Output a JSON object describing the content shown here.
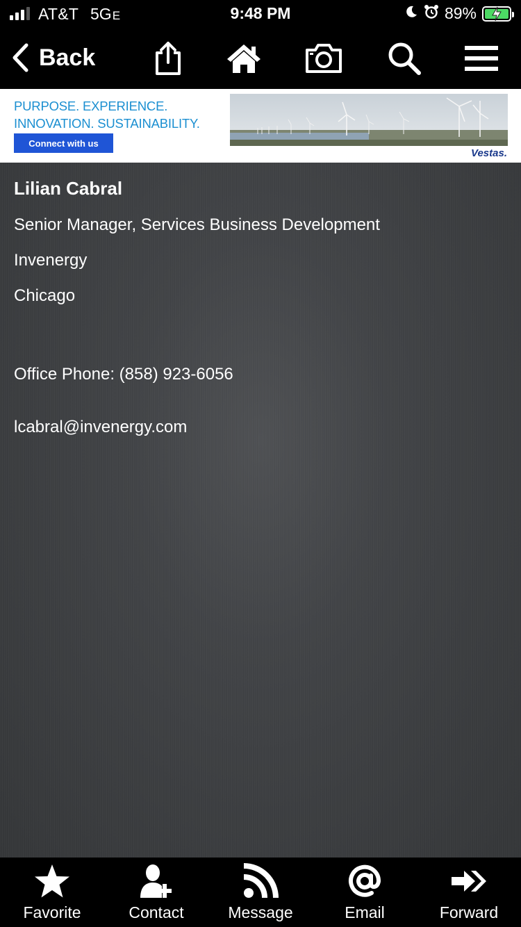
{
  "status_bar": {
    "carrier": "AT&T",
    "network": "5G",
    "network_suffix": "E",
    "time": "9:48 PM",
    "battery": "89%"
  },
  "toolbar": {
    "back_label": "Back"
  },
  "ad": {
    "slogan_line1": "PURPOSE. EXPERIENCE.",
    "slogan_line2": "INNOVATION. SUSTAINABILITY.",
    "cta_label": "Connect with us",
    "brand": "Vestas."
  },
  "contact": {
    "name": "Lilian Cabral",
    "title": "Senior Manager, Services Business Development",
    "company": "Invenergy",
    "city": "Chicago",
    "phone": "Office Phone: (858) 923-6056",
    "email": "lcabral@invenergy.com"
  },
  "tabbar": {
    "favorite": "Favorite",
    "contact": "Contact",
    "message": "Message",
    "email": "Email",
    "forward": "Forward"
  },
  "colors": {
    "accent_blue": "#1b8fd1",
    "cta_blue": "#1f55d6",
    "battery_green": "#4cd964"
  }
}
